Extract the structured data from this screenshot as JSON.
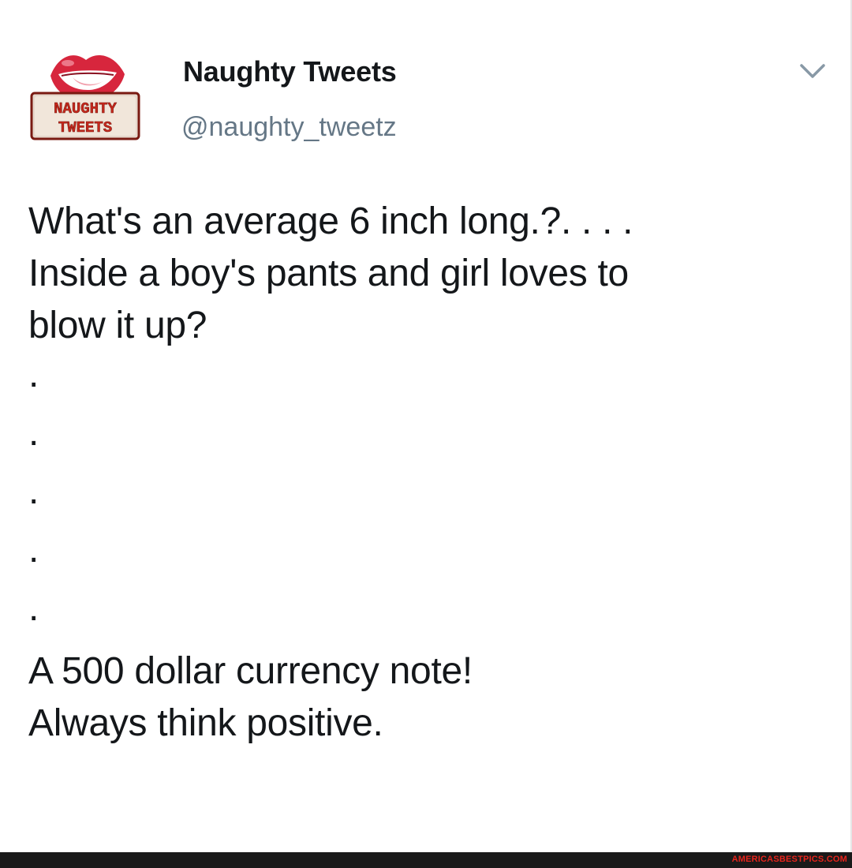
{
  "tweet": {
    "author": {
      "display_name": "Naughty Tweets",
      "handle": "@naughty_tweetz",
      "avatar": {
        "icon": "lips-logo-icon",
        "text_line1": "NAUGHTY",
        "text_line2": "TWEETS"
      }
    },
    "menu_icon": "chevron-down-icon",
    "body_lines": [
      "What's an average 6 inch long.?. . . .",
      "Inside a boy's pants and girl loves to",
      "blow it up?"
    ],
    "dots": [
      ".",
      ".",
      ".",
      ".",
      "."
    ],
    "answer_lines": [
      "A 500 dollar currency note!",
      "Always think positive."
    ]
  },
  "footer": {
    "watermark": "AMERICASBESTPICS.COM"
  },
  "colors": {
    "text": "#14171a",
    "handle": "#657786",
    "caret": "#8899a6",
    "logo_red": "#d7263d",
    "watermark": "#e8241c",
    "footer_bg": "#1a1a1a"
  }
}
